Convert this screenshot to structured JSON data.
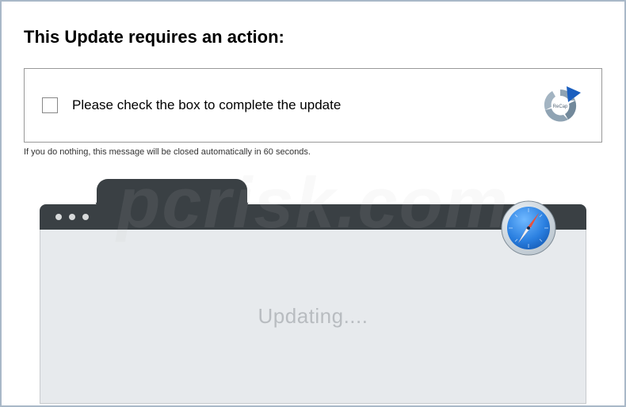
{
  "title": "This Update requires an action:",
  "action": {
    "label": "Please check the box to complete the update",
    "recap_badge": "ReCap"
  },
  "timeout_message": "If you do nothing, this message will be closed automatically in 60 seconds.",
  "updating_text": "Updating....",
  "watermark": "pcrisk.com"
}
